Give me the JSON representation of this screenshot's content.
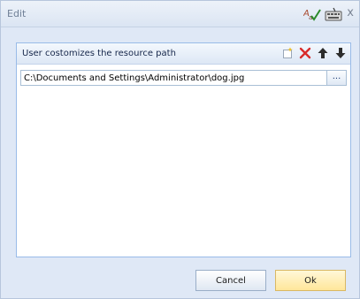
{
  "window": {
    "title": "Edit",
    "toolbar_icons": [
      "spell-check-icon",
      "keyboard-icon"
    ],
    "close_glyph": "x"
  },
  "panel": {
    "title": "User costomizes the resource path",
    "tools": [
      "new-row-icon",
      "delete-icon",
      "move-up-icon",
      "move-down-icon"
    ],
    "path_value": "C:\\Documents and Settings\\Administrator\\dog.jpg",
    "browse_label": "..."
  },
  "footer": {
    "cancel_label": "Cancel",
    "ok_label": "Ok"
  },
  "colors": {
    "accent": "#99bbe8",
    "delete": "#d82b2b",
    "ok_button": "#ffe69a"
  }
}
